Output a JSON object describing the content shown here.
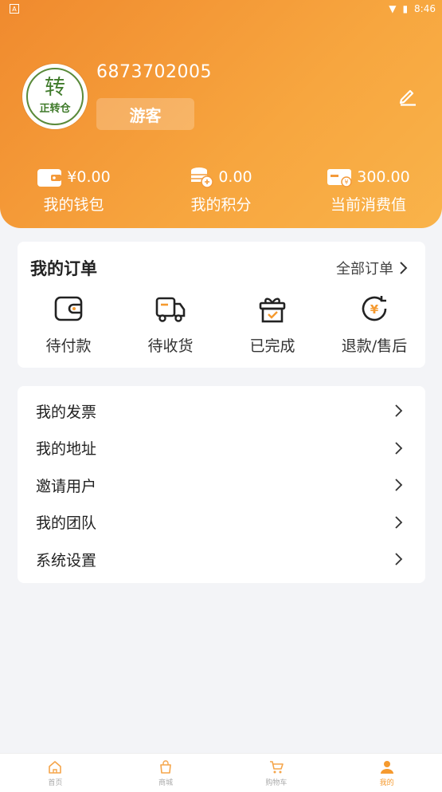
{
  "status_bar": {
    "left": "A",
    "time": "8:46"
  },
  "profile": {
    "user_id": "6873702005",
    "role": "游客",
    "avatar_text": "正转仓"
  },
  "stats": [
    {
      "value": "¥0.00",
      "label": "我的钱包",
      "icon": "wallet-icon"
    },
    {
      "value": "0.00",
      "label": "我的积分",
      "icon": "coins-icon"
    },
    {
      "value": "300.00",
      "label": "当前消费值",
      "icon": "card-icon"
    }
  ],
  "orders": {
    "title": "我的订单",
    "all_label": "全部订单",
    "items": [
      {
        "label": "待付款",
        "icon": "wallet-icon"
      },
      {
        "label": "待收货",
        "icon": "truck-icon"
      },
      {
        "label": "已完成",
        "icon": "gift-icon"
      },
      {
        "label": "退款/售后",
        "icon": "refund-icon"
      }
    ]
  },
  "menu": [
    {
      "label": "我的发票"
    },
    {
      "label": "我的地址"
    },
    {
      "label": "邀请用户"
    },
    {
      "label": "我的团队"
    },
    {
      "label": "系统设置"
    }
  ],
  "tabbar": [
    {
      "label": "首页",
      "icon": "home-icon"
    },
    {
      "label": "商城",
      "icon": "bag-icon"
    },
    {
      "label": "购物车",
      "icon": "cart-icon"
    },
    {
      "label": "我的",
      "icon": "user-icon",
      "active": true
    }
  ],
  "colors": {
    "accent": "#f59a2f",
    "header_start": "#f08a2e",
    "header_end": "#f9b34a"
  }
}
